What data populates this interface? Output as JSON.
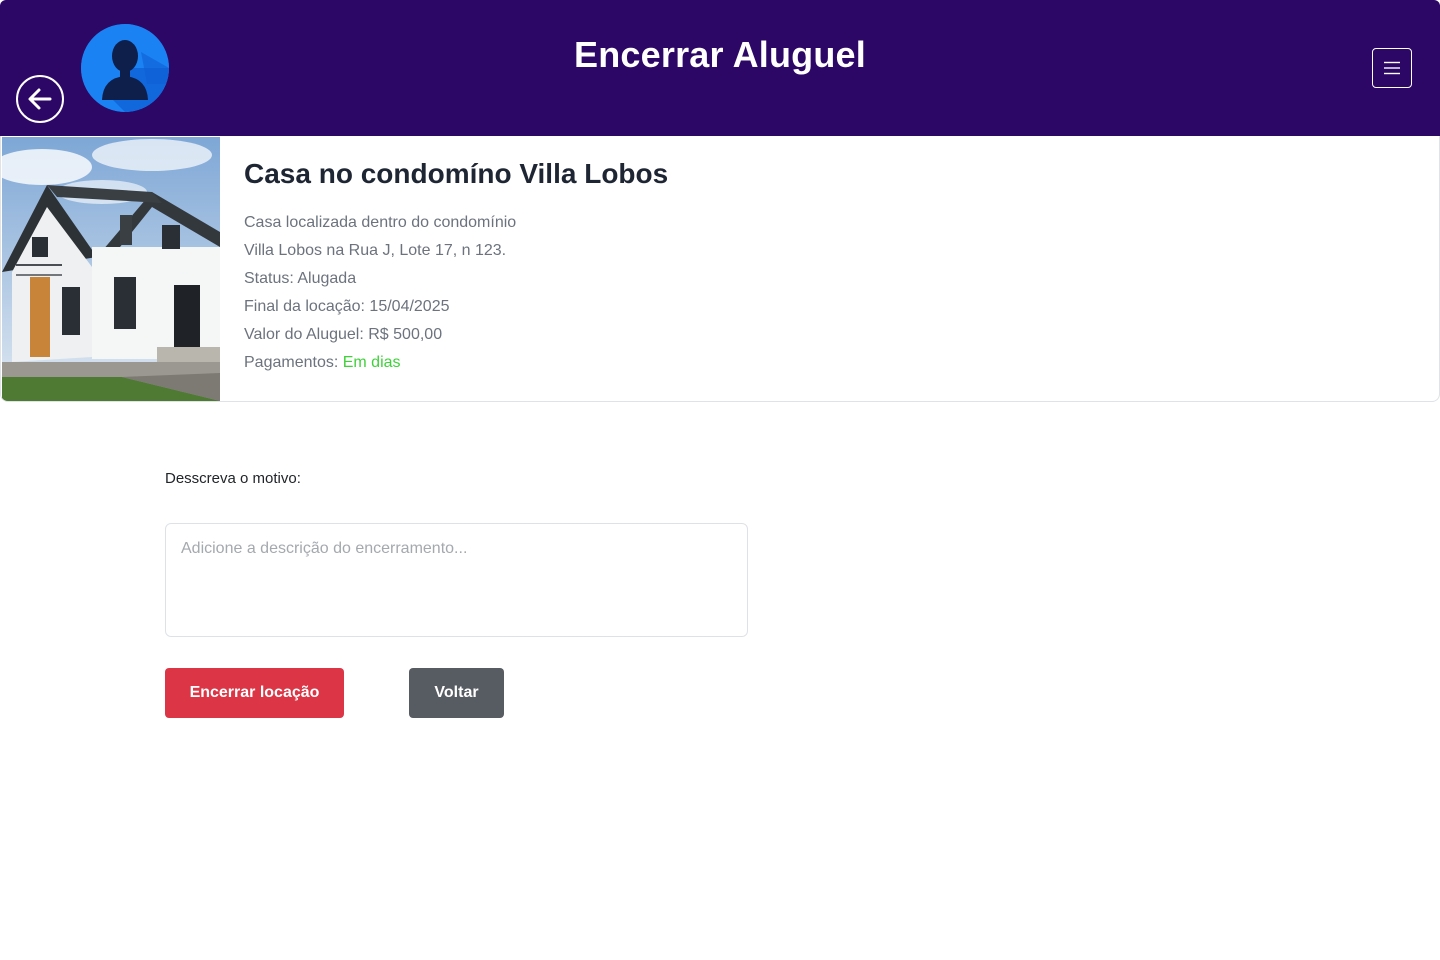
{
  "header": {
    "title": "Encerrar Aluguel",
    "back_icon": "arrow-left-icon",
    "avatar_icon": "user-avatar-icon",
    "menu_icon": "hamburger-menu-icon",
    "bg_color": "#2c0766"
  },
  "property": {
    "image_icon": "house-photo",
    "title": "Casa no condomíno Villa Lobos",
    "description_line1": "Casa localizada dentro do condomínio",
    "description_line2": "Villa Lobos na Rua J, Lote 17, n 123.",
    "status_label": "Status:",
    "status_value": "Alugada",
    "end_label": "Final da locação:",
    "end_value": "15/04/2025",
    "rent_label": "Valor do Aluguel:",
    "rent_value": "R$ 500,00",
    "payments_label": "Pagamentos:",
    "payments_value": "Em dias",
    "payments_color": "#3fd13a"
  },
  "form": {
    "label": "Desscreva o motivo:",
    "placeholder": "Adicione a descrição do encerramento...",
    "value": "",
    "submit_label": "Encerrar locação",
    "submit_color": "#dc3545",
    "back_label": "Voltar",
    "back_color": "#575b62"
  }
}
